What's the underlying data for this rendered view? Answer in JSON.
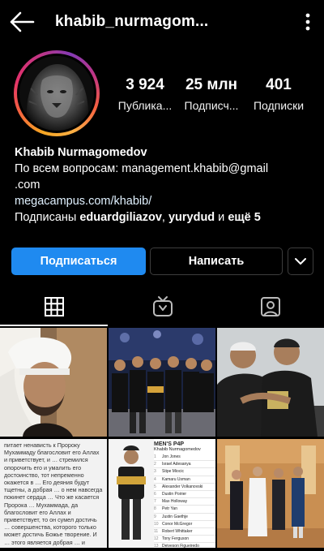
{
  "header": {
    "username": "khabib_nurmagom...",
    "back_icon": "back-arrow-icon",
    "more_icon": "more-vertical-icon"
  },
  "profile": {
    "stats": [
      {
        "value": "3 924",
        "label": "Публика..."
      },
      {
        "value": "25 млн",
        "label": "Подписч..."
      },
      {
        "value": "401",
        "label": "Подписки"
      }
    ],
    "name": "Khabib Nurmagomedov",
    "bio_line1": "По всем вопросам: management.khabib@gmail",
    "bio_line2": ".com",
    "website": "megacampus.com/khabib/",
    "followed_by_prefix": "Подписаны ",
    "followed_by_user1": "eduardgiliazov",
    "followed_by_sep": ", ",
    "followed_by_user2": "yurydud",
    "followed_by_and": " и ",
    "followed_by_more": "ещё 5"
  },
  "actions": {
    "follow": "Подписаться",
    "message": "Написать"
  },
  "tabs": [
    {
      "icon": "grid-icon",
      "active": true
    },
    {
      "icon": "igtv-icon",
      "active": false
    },
    {
      "icon": "tagged-icon",
      "active": false
    }
  ],
  "posts": {
    "p4_text": "питает ненависть к Пророку Мухаммаду благословит его Аллах и приветствует, и … стремился опорочить его и умалить его достоинство, тот непременно окажется в … Его деяния будут тщетны, а добрая … о нем навсегда покинет сердца … Что же касается Пророка … Мухаммада, да благословит его Аллах и приветствует, то он сумел достичь … совершенства, которого только может достичь Божье творение. И … этого является добрая … и многочисленность его … сторонников и последователей.",
    "p5_header": "MEN'S P4P",
    "p5_sub": "Khabib Nurmagomedov",
    "p5_rows": [
      "Jon Jones",
      "Israel Adesanya",
      "Stipe Miocic",
      "Kamaru Usman",
      "Alexander Volkanovski",
      "Dustin Poirier",
      "Max Holloway",
      "Petr Yan",
      "Justin Gaethje",
      "Conor McGregor",
      "Robert Whittaker",
      "Tony Ferguson",
      "Deiveson Figueiredo",
      "Francis Ngannou"
    ]
  }
}
